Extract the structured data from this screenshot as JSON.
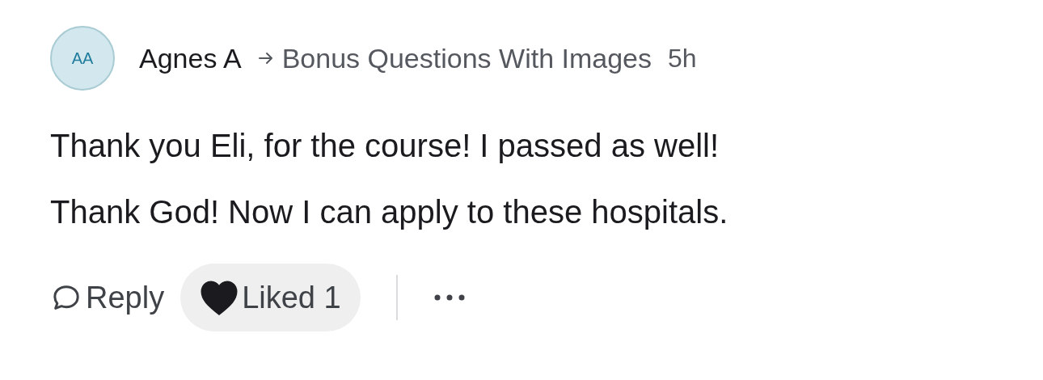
{
  "post": {
    "author": {
      "initials": "AA",
      "name": "Agnes A"
    },
    "topic": "Bonus Questions With Images",
    "time": "5h",
    "body": [
      "Thank you Eli, for the course! I passed as well!",
      "Thank God! Now I can apply to these hospitals."
    ]
  },
  "actions": {
    "reply": "Reply",
    "like": {
      "label": "Liked 1",
      "liked": true
    }
  }
}
